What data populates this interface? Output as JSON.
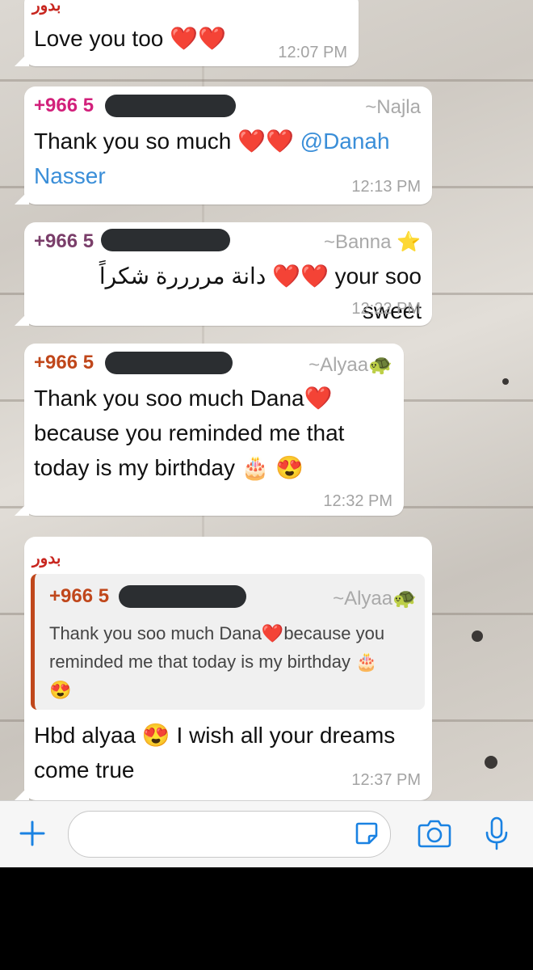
{
  "messages": [
    {
      "sender_label": "بدور",
      "text": "Love you too ❤️❤️",
      "time": "12:07 PM"
    },
    {
      "phone_prefix": "+966 5",
      "alias": "~Najla",
      "text_before": "Thank you so much ❤️❤️ ",
      "mention_1": "@Danah",
      "mention_2": "Nasser",
      "time": "12:13 PM"
    },
    {
      "phone_prefix": "+966 5",
      "alias": "~Banna ⭐",
      "text": "دانة مررررة شكراً ❤️❤️ your soo sweet",
      "time": "12:22 PM"
    },
    {
      "phone_prefix": "+966 5",
      "alias": "~Alyaa🐢",
      "line_1": "Thank you soo much Dana❤️",
      "line_2": "because you reminded me that",
      "line_3": "today is my birthday 🎂 😍",
      "time": "12:32 PM"
    },
    {
      "sender_label": "بدور",
      "quote_phone_prefix": "+966 5",
      "quote_alias": "~Alyaa🐢",
      "quote_line_1": "Thank you soo much Dana❤️because you",
      "quote_line_2": "reminded me that today is my birthday 🎂",
      "quote_line_3": "😍",
      "line_1": "Hbd alyaa 😍  I wish all your dreams",
      "line_2": "come true",
      "time": "12:37 PM"
    }
  ],
  "input_bar": {
    "placeholder": "",
    "icons": [
      "plus-icon",
      "sticker-icon",
      "camera-icon",
      "microphone-icon"
    ]
  },
  "colors": {
    "accent": "#1a82e2",
    "sender_red": "#c8261f",
    "phone_pink": "#d2207b",
    "phone_purple": "#7a3e6a",
    "phone_orange": "#c0471b",
    "timestamp": "#a3a3a3"
  }
}
